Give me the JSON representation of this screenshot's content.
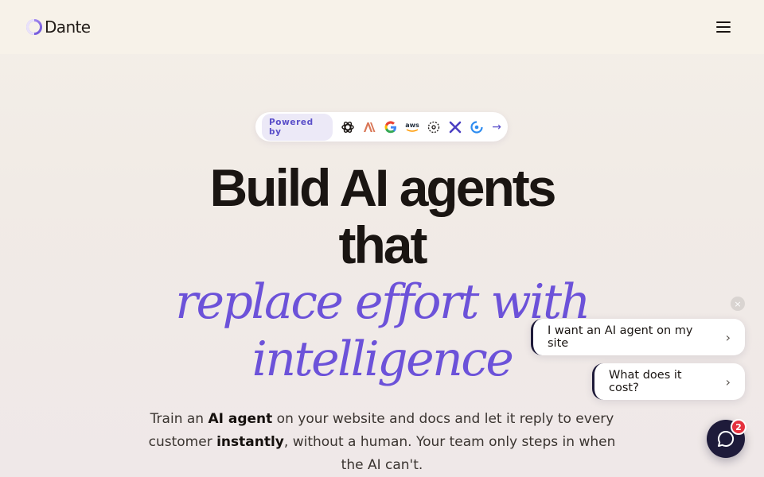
{
  "header": {
    "logo_text": "Dante",
    "menu_icon": "hamburger-icon"
  },
  "powered_by": {
    "label": "Powered by",
    "providers": [
      "openai-icon",
      "anthropic-icon",
      "google-icon",
      "aws-icon",
      "perplexity-icon",
      "xai-icon",
      "deepseek-icon"
    ],
    "arrow": "→"
  },
  "hero": {
    "line1": "Build AI agents",
    "line2": "that",
    "line3": "replace effort with",
    "line4": "intelligence"
  },
  "subtext": {
    "part1": "Train an ",
    "bold1": "AI agent",
    "part2": " on your website and docs and let it reply to every customer ",
    "bold2": "instantly",
    "part3": ", without a human. Your team only steps in when the AI can't."
  },
  "chat": {
    "close": "×",
    "suggestion1": "I want an AI agent on my site",
    "suggestion2": "What does it cost?",
    "chevron": "›",
    "badge_count": "2"
  },
  "colors": {
    "accent": "#6c52d9",
    "launcher": "#1e1b3a",
    "badge": "#e5323e"
  }
}
